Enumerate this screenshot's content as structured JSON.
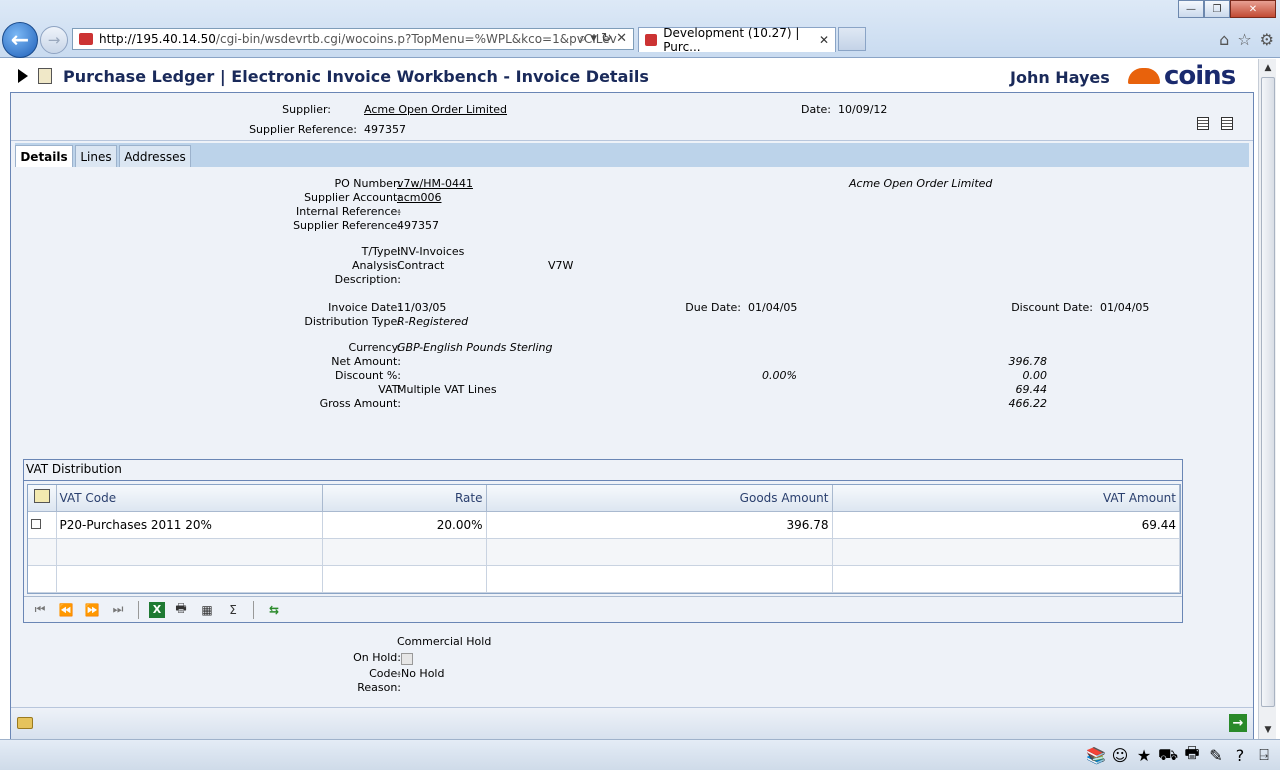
{
  "browser": {
    "url_host": "http://195.40.14.50",
    "url_rest": "/cgi-bin/wsdevrtb.cgi/wocoins.p?TopMenu=%WPL&kco=1&pvCILev",
    "tab_title": "Development (10.27) | Purc...",
    "tab_close": "✕"
  },
  "header": {
    "title": "Purchase Ledger | Electronic Invoice Workbench - Invoice Details",
    "user": "John Hayes",
    "logo_text": "coins"
  },
  "supplier_panel": {
    "supplier_label": "Supplier:",
    "supplier_value": "Acme Open Order Limited",
    "date_label": "Date:",
    "date_value": "10/09/12",
    "supref_label": "Supplier Reference:",
    "supref_value": "497357"
  },
  "tabs": [
    {
      "label": "Details"
    },
    {
      "label": "Lines"
    },
    {
      "label": "Addresses"
    }
  ],
  "details": {
    "po_label": "PO Number:",
    "po_value": "v7w/HM-0441",
    "supname": "Acme Open Order Limited",
    "acct_label": "Supplier Account:",
    "acct_value": "acm006",
    "intref_label": "Internal Reference:",
    "intref_value": "-",
    "supref_label": "Supplier Reference:",
    "supref_value": "497357",
    "ttype_label": "T/Type:",
    "ttype_value": "INV-Invoices",
    "analysis_label": "Analysis:",
    "analysis_value": "Contract",
    "analysis_code": "V7W",
    "desc_label": "Description:",
    "invdate_label": "Invoice Date:",
    "invdate_value": "11/03/05",
    "duedate_label": "Due Date:",
    "duedate_value": "01/04/05",
    "discdate_label": "Discount Date:",
    "discdate_value": "01/04/05",
    "disttype_label": "Distribution Type:",
    "disttype_value": "R-Registered",
    "currency_label": "Currency:",
    "currency_value": "GBP-English Pounds Sterling",
    "net_label": "Net Amount:",
    "net_value": "396.78",
    "discpct_label": "Discount %:",
    "discpct_value": "0.00%",
    "disc_value": "0.00",
    "vat_label": "VAT:",
    "vat_value": "Multiple VAT Lines",
    "vat_amount": "69.44",
    "gross_label": "Gross Amount:",
    "gross_value": "466.22"
  },
  "vat_distribution": {
    "caption": "VAT Distribution",
    "columns": [
      "VAT Code",
      "Rate",
      "Goods Amount",
      "VAT Amount"
    ],
    "rows": [
      {
        "code": "P20-Purchases 2011 20%",
        "rate": "20.00%",
        "goods": "396.78",
        "vat": "69.44"
      }
    ]
  },
  "hold": {
    "heading": "Commercial Hold",
    "onhold_label": "On Hold:",
    "code_label": "Code:",
    "code_value": "-No Hold",
    "reason_label": "Reason:"
  },
  "pager_icons": [
    "first-icon",
    "prev-icon",
    "next-icon",
    "last-icon",
    "excel-icon",
    "print-icon",
    "calculator-icon",
    "sum-icon",
    "refresh-icon"
  ],
  "pager_glyphs": {
    "first": "⏮",
    "prev": "⏪",
    "next": "⏩",
    "last": "⏭",
    "excel": "X",
    "print": "🖶",
    "calc": "▦",
    "sum": "Σ",
    "refresh": "⇆"
  }
}
